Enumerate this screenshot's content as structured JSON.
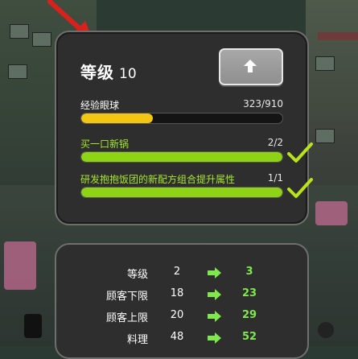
{
  "level_panel": {
    "title": "等级",
    "level": "10",
    "upgrade_icon": "up-arrow-icon"
  },
  "progress": [
    {
      "label": "经验眼球",
      "value": "323/910",
      "fraction": 0.355,
      "fill_color": "#f2c612",
      "label_color": "#ffffff",
      "checked": false
    },
    {
      "label": "买一口新锅",
      "value": "2/2",
      "fraction": 1.0,
      "fill_color": "#8fd414",
      "label_color": "#a6e82c",
      "checked": true
    },
    {
      "label": "研发抱抱饭团的新配方组合提升属性",
      "value": "1/1",
      "fraction": 1.0,
      "fill_color": "#8fd414",
      "label_color": "#a6e82c",
      "checked": true
    }
  ],
  "stats": [
    {
      "name": "等级",
      "current": "2",
      "next": "3"
    },
    {
      "name": "顾客下限",
      "current": "18",
      "next": "23"
    },
    {
      "name": "顾客上限",
      "current": "20",
      "next": "29"
    },
    {
      "name": "料理",
      "current": "48",
      "next": "52"
    }
  ],
  "colors": {
    "accent_green": "#7ee84d",
    "pointer_red": "#d8211c",
    "check_green": "#b9e21a"
  }
}
